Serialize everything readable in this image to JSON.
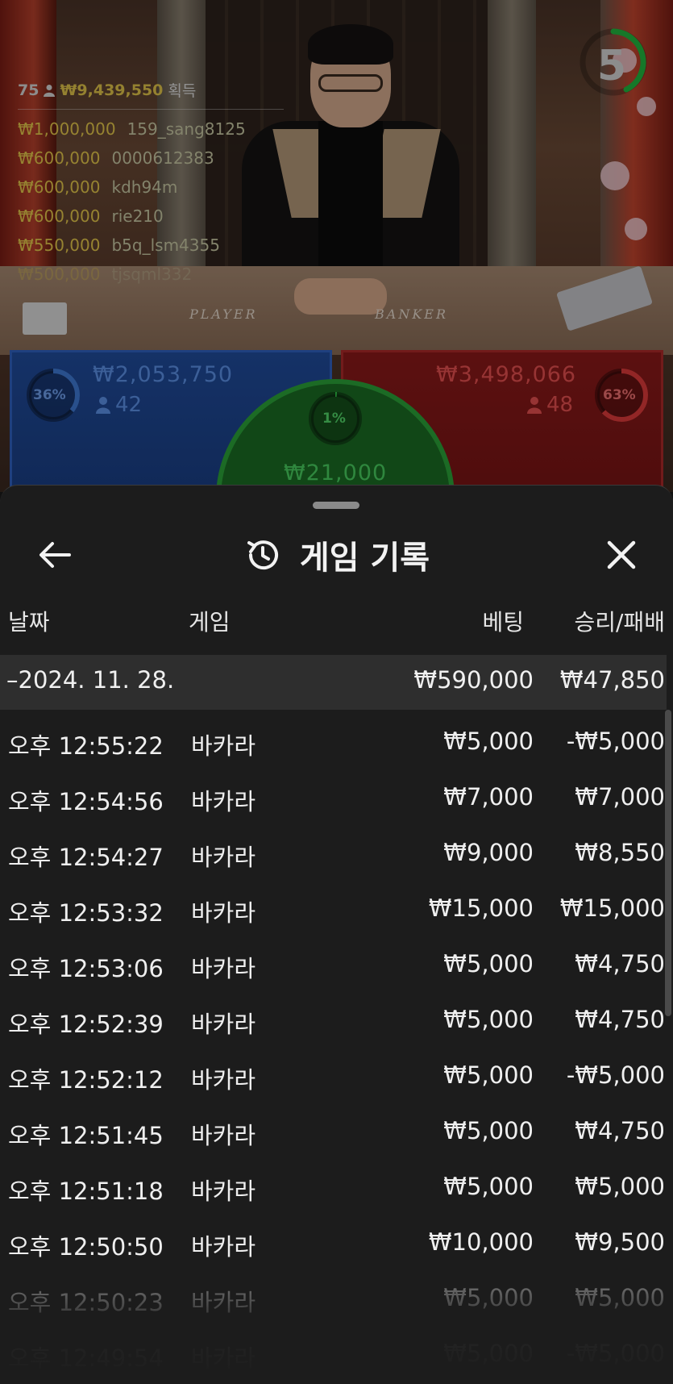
{
  "live": {
    "countdown": "5",
    "winners": {
      "count": "75",
      "total": "₩9,439,550",
      "total_label": "획득",
      "list": [
        {
          "amount": "₩1,000,000",
          "user": "159_sang8125"
        },
        {
          "amount": "₩600,000",
          "user": "0000612383"
        },
        {
          "amount": "₩600,000",
          "user": "kdh94m"
        },
        {
          "amount": "₩600,000",
          "user": "rie210"
        },
        {
          "amount": "₩550,000",
          "user": "b5q_lsm4355"
        },
        {
          "amount": "₩500,000",
          "user": "tjsqml332"
        }
      ]
    },
    "table_labels": {
      "player": "PLAYER",
      "banker": "BANKER"
    },
    "player": {
      "percent": "36%",
      "percent_value": 36,
      "amount": "₩2,053,750",
      "count": "42"
    },
    "banker": {
      "percent": "63%",
      "percent_value": 63,
      "amount": "₩3,498,066",
      "count": "48"
    },
    "tie": {
      "percent": "1%",
      "percent_value": 1,
      "amount": "₩21,000"
    },
    "colors": {
      "player": "#3f7bd8",
      "banker": "#e03b3b",
      "tie": "#2fc447",
      "gold": "#e3c64a"
    }
  },
  "history": {
    "title": "게임 기록",
    "icons": {
      "back": "arrow-left-icon",
      "title": "history-icon",
      "close": "close-icon"
    },
    "columns": {
      "date": "날짜",
      "game": "게임",
      "bet": "베팅",
      "result": "승리/패배"
    },
    "group": {
      "date": "–2024. 11. 28.",
      "bet": "₩590,000",
      "result": "₩47,850"
    },
    "rows": [
      {
        "time": "오후 12:55:22",
        "game": "바카라",
        "bet": "₩5,000",
        "result": "-₩5,000"
      },
      {
        "time": "오후 12:54:56",
        "game": "바카라",
        "bet": "₩7,000",
        "result": "₩7,000"
      },
      {
        "time": "오후 12:54:27",
        "game": "바카라",
        "bet": "₩9,000",
        "result": "₩8,550"
      },
      {
        "time": "오후 12:53:32",
        "game": "바카라",
        "bet": "₩15,000",
        "result": "₩15,000"
      },
      {
        "time": "오후 12:53:06",
        "game": "바카라",
        "bet": "₩5,000",
        "result": "₩4,750"
      },
      {
        "time": "오후 12:52:39",
        "game": "바카라",
        "bet": "₩5,000",
        "result": "₩4,750"
      },
      {
        "time": "오후 12:52:12",
        "game": "바카라",
        "bet": "₩5,000",
        "result": "-₩5,000"
      },
      {
        "time": "오후 12:51:45",
        "game": "바카라",
        "bet": "₩5,000",
        "result": "₩4,750"
      },
      {
        "time": "오후 12:51:18",
        "game": "바카라",
        "bet": "₩5,000",
        "result": "₩5,000"
      },
      {
        "time": "오후 12:50:50",
        "game": "바카라",
        "bet": "₩10,000",
        "result": "₩9,500"
      },
      {
        "time": "오후 12:50:23",
        "game": "바카라",
        "bet": "₩5,000",
        "result": "₩5,000"
      },
      {
        "time": "오후 12:49:54",
        "game": "바카라",
        "bet": "₩5,000",
        "result": "-₩5,000"
      }
    ]
  }
}
